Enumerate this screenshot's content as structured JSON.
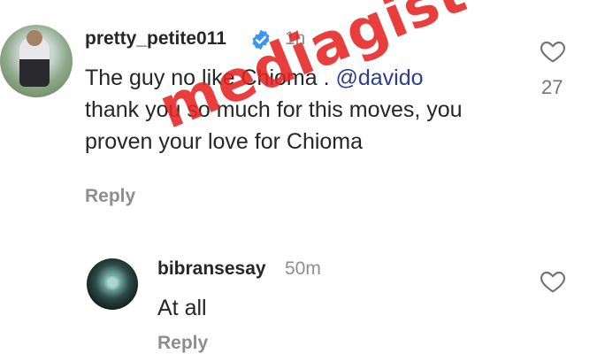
{
  "comments": [
    {
      "username": "pretty_petite011",
      "verified": true,
      "time": "1h",
      "text_before": "The guy no like Chioma . ",
      "mention": "@davido",
      "text_line2": "thank you so much for this moves, you",
      "text_line3": "proven your love for Chioma",
      "reply_label": "Reply",
      "like_count": "27",
      "icons": {
        "like": "heart-outline-icon",
        "badge": "verified-badge-icon"
      }
    },
    {
      "username": "bibransesay",
      "time": "50m",
      "text": "At all",
      "reply_label": "Reply",
      "icons": {
        "like": "heart-outline-icon"
      }
    }
  ],
  "watermark": "mediagist",
  "colors": {
    "verified": "#3897f0",
    "watermark": "#e62323",
    "mention": "#2c3e8c"
  }
}
